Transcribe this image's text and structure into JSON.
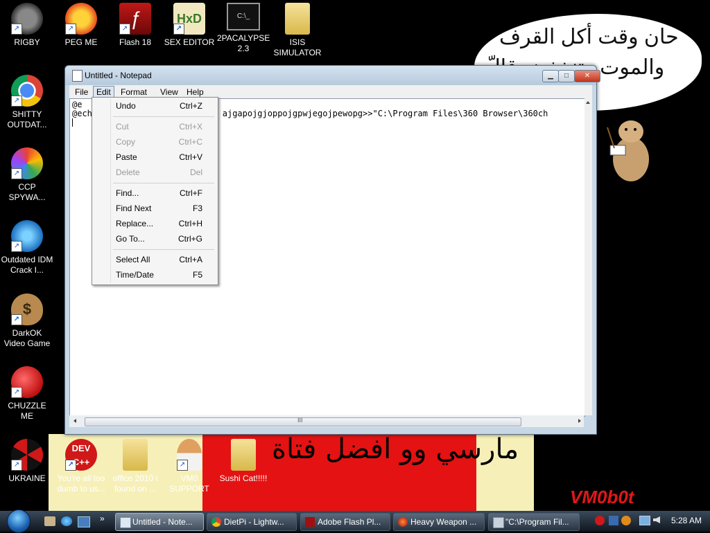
{
  "desktop_icons": [
    {
      "label": "RIGBY",
      "icon": "raccoon-icon"
    },
    {
      "label": "PEG ME",
      "icon": "peg-icon"
    },
    {
      "label": "Flash 18",
      "icon": "flash-icon"
    },
    {
      "label": "SEX EDITOR",
      "icon": "hxd-icon"
    },
    {
      "label": "2PACALYPSE 2.3",
      "icon": "terminal-icon"
    },
    {
      "label": "ISIS SIMULATOR",
      "icon": "folder-icon"
    },
    {
      "label": "SHITTY OUTDAT...",
      "icon": "chrome-icon"
    },
    {
      "label": "CCP SPYWA...",
      "icon": "pinwheel-icon"
    },
    {
      "label": "Outdated IDM Crack I...",
      "icon": "globe-download-icon"
    },
    {
      "label": "DarkOK Video Game",
      "icon": "money-bag-icon"
    },
    {
      "label": "CHUZZLE ME",
      "icon": "chuzzle-icon"
    },
    {
      "label": "UKRAINE",
      "icon": "radiation-icon"
    },
    {
      "label": "You're all too dumb to us...",
      "icon": "devcpp-icon"
    },
    {
      "label": "office 2010 i found on ...",
      "icon": "folder-icon"
    },
    {
      "label": "VM0 SUPPORT",
      "icon": "person-icon"
    },
    {
      "label": "Sushi Cat!!!!!",
      "icon": "folder-icon"
    }
  ],
  "wallpaper": {
    "speech_line1": "حان وقت أكل القرف",
    "speech_line2": "والموت وتنخفض قالّ",
    "banner_text": "مارسي وو افضل فتاة",
    "signature": "VM0b0t"
  },
  "notepad": {
    "title": "Untitled - Notepad",
    "menus": [
      "File",
      "Edit",
      "Format",
      "View",
      "Help"
    ],
    "content_line1": "@e",
    "content_line2": "@ech                          ajgapojgjoppojgpwjegojpewopg>>\"C:\\Program Files\\360 Browser\\360ch",
    "minimize_glyph": "▁",
    "maximize_glyph": "□",
    "close_glyph": "✕",
    "scroll_grip": "III"
  },
  "edit_menu": {
    "items": [
      {
        "label": "Undo",
        "shortcut": "Ctrl+Z",
        "enabled": true
      },
      {
        "label": "Cut",
        "shortcut": "Ctrl+X",
        "enabled": false
      },
      {
        "label": "Copy",
        "shortcut": "Ctrl+C",
        "enabled": false
      },
      {
        "label": "Paste",
        "shortcut": "Ctrl+V",
        "enabled": true
      },
      {
        "label": "Delete",
        "shortcut": "Del",
        "enabled": false
      },
      {
        "label": "Find...",
        "shortcut": "Ctrl+F",
        "enabled": true
      },
      {
        "label": "Find Next",
        "shortcut": "F3",
        "enabled": true
      },
      {
        "label": "Replace...",
        "shortcut": "Ctrl+H",
        "enabled": true
      },
      {
        "label": "Go To...",
        "shortcut": "Ctrl+G",
        "enabled": true
      },
      {
        "label": "Select All",
        "shortcut": "Ctrl+A",
        "enabled": true
      },
      {
        "label": "Time/Date",
        "shortcut": "F5",
        "enabled": true
      }
    ]
  },
  "taskbar": {
    "buttons": [
      {
        "label": "Untitled - Note...",
        "icon": "notepad-icon",
        "active": true
      },
      {
        "label": "DietPi - Lightw...",
        "icon": "chrome-icon",
        "active": false
      },
      {
        "label": "Adobe Flash Pl...",
        "icon": "flash-icon",
        "active": false
      },
      {
        "label": "Heavy Weapon ...",
        "icon": "heavy-weapon-icon",
        "active": false
      },
      {
        "label": "\"C:\\Program Fil...",
        "icon": "program-icon",
        "active": false
      }
    ],
    "clock": "5:28 AM",
    "overflow_glyph": "»"
  },
  "colors": {
    "desktop_bg": "#000000",
    "banner_red": "#e41212",
    "banner_cream": "#f6f0b8",
    "window_frame": "#c7d7e6",
    "menu_bg": "#f5f5f5",
    "disabled_text": "#9a9a9a"
  }
}
